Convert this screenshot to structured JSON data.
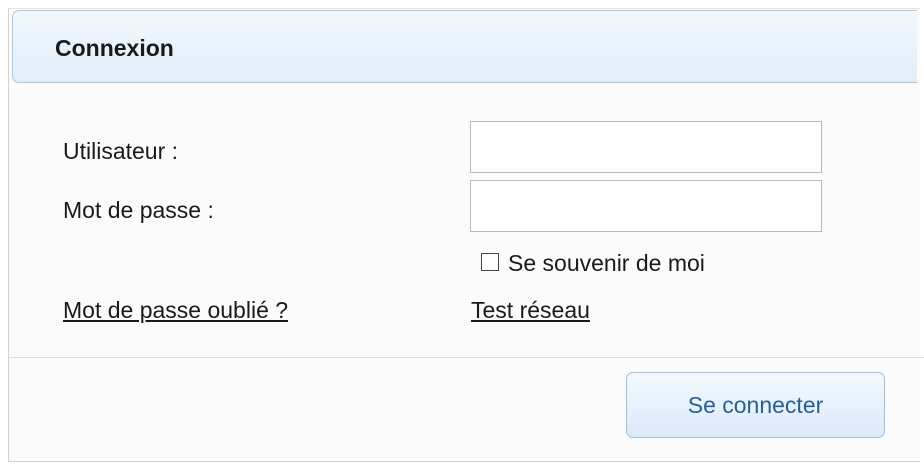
{
  "dialog": {
    "title": "Connexion",
    "user_label": "Utilisateur :",
    "user_value": "",
    "password_label": "Mot de passe :",
    "password_value": "",
    "remember_label": "Se souvenir de moi",
    "remember_checked": false,
    "forgot_link": "Mot de passe oublié ?",
    "network_test_link": "Test réseau",
    "connect_button": "Se connecter"
  },
  "colors": {
    "header_border": "#a9cbe6",
    "header_bg": "#dfeefa",
    "button_text": "#2a5f93"
  }
}
